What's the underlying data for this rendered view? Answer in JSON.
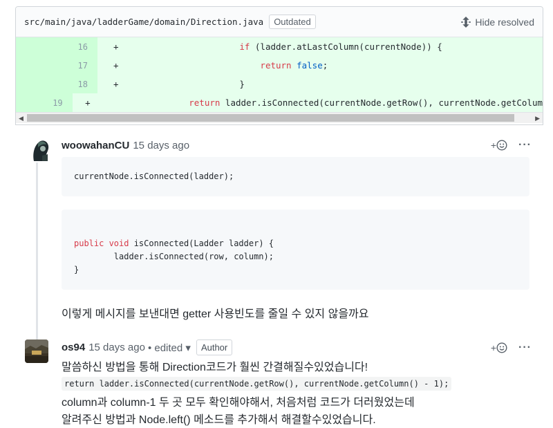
{
  "file": {
    "path": "src/main/java/ladderGame/domain/Direction.java",
    "status_badge": "Outdated",
    "hide_resolved_label": "Hide resolved"
  },
  "diff_lines": [
    {
      "num": "16",
      "sign": "+",
      "indent": "            ",
      "kw": "if",
      "rest": " (ladder.atLastColumn(currentNode)) {"
    },
    {
      "num": "17",
      "sign": "+",
      "indent": "                ",
      "kw": "return",
      "lit": "false",
      "rest": ";"
    },
    {
      "num": "18",
      "sign": "+",
      "indent": "            ",
      "rest": "}"
    },
    {
      "num": "19",
      "sign": "+",
      "indent": "            ",
      "kw": "return",
      "rest": " ladder.isConnected(currentNode.getRow(), currentNode.getColum"
    }
  ],
  "comments": [
    {
      "author": "woowahanCU",
      "time": "15 days ago",
      "code1": "currentNode.isConnected(ladder);",
      "code2_line1_kw": "public void",
      "code2_line1_rest": " isConnected(Ladder ladder) {",
      "code2_line2": "        ladder.isConnected(row, column);",
      "code2_line3": "}",
      "body": "이렇게 메시지를 보낸대면 getter 사용빈도를 줄일 수 있지 않을까요"
    },
    {
      "author": "os94",
      "time": "15 days ago",
      "edited": "• edited ▾",
      "badge": "Author",
      "line1": "말씀하신 방법을 통해 Direction코드가 훨씬 간결해질수있었습니다!",
      "code": "return ladder.isConnected(currentNode.getRow(), currentNode.getColumn() - 1);",
      "line2": "column과 column-1 두 곳 모두 확인해야해서, 처음처럼 코드가 더러웠었는데",
      "line3": "알려주신 방법과 Node.left() 메소드를 추가해서 해결할수있었습니다."
    }
  ],
  "actions": {
    "reaction_icon": "smiley-plus-icon",
    "more_icon": "kebab-icon",
    "more_label": "···",
    "plus": "+"
  }
}
